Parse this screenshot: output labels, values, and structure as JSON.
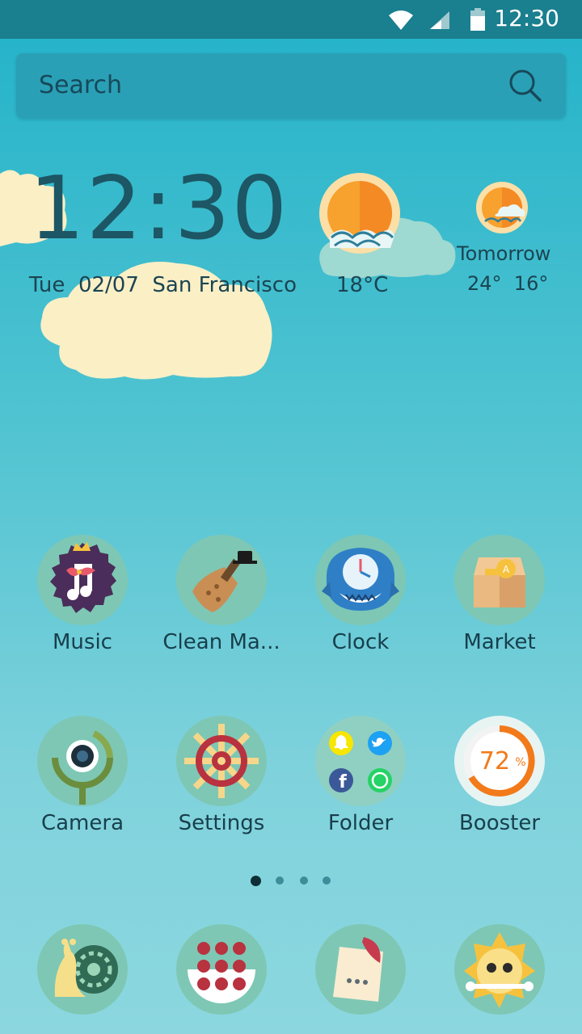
{
  "status_bar": {
    "time": "12:30"
  },
  "search": {
    "placeholder": "Search"
  },
  "clock_widget": {
    "time": "12:30",
    "date_line": "Tue  02/07  San Francisco",
    "temperature": "18°C",
    "tomorrow_label": "Tomorrow",
    "tomorrow_temps": "24°  16°"
  },
  "apps": [
    {
      "label": "Music",
      "icon": "music-icon"
    },
    {
      "label": "Clean Ma...",
      "icon": "broom-icon"
    },
    {
      "label": "Clock",
      "icon": "clock-icon"
    },
    {
      "label": "Market",
      "icon": "market-icon"
    },
    {
      "label": "Camera",
      "icon": "camera-icon"
    },
    {
      "label": "Settings",
      "icon": "settings-icon"
    },
    {
      "label": "Folder",
      "icon": "folder-icon"
    },
    {
      "label": "Booster",
      "icon": "booster-icon"
    }
  ],
  "booster_percent": "72",
  "booster_percent_sign": "%",
  "page_indicator": {
    "count": 4,
    "active": 0
  },
  "dock": [
    {
      "icon": "phone-icon"
    },
    {
      "icon": "apps-drawer-icon"
    },
    {
      "icon": "messages-icon"
    },
    {
      "icon": "browser-icon"
    }
  ],
  "colors": {
    "status_bar": "#1a7f8f",
    "search_bg": "#2aa0b6",
    "text_dark": "#1b4452",
    "cloud": "#fbefc6",
    "icon_circle": "#7ec7b4"
  }
}
